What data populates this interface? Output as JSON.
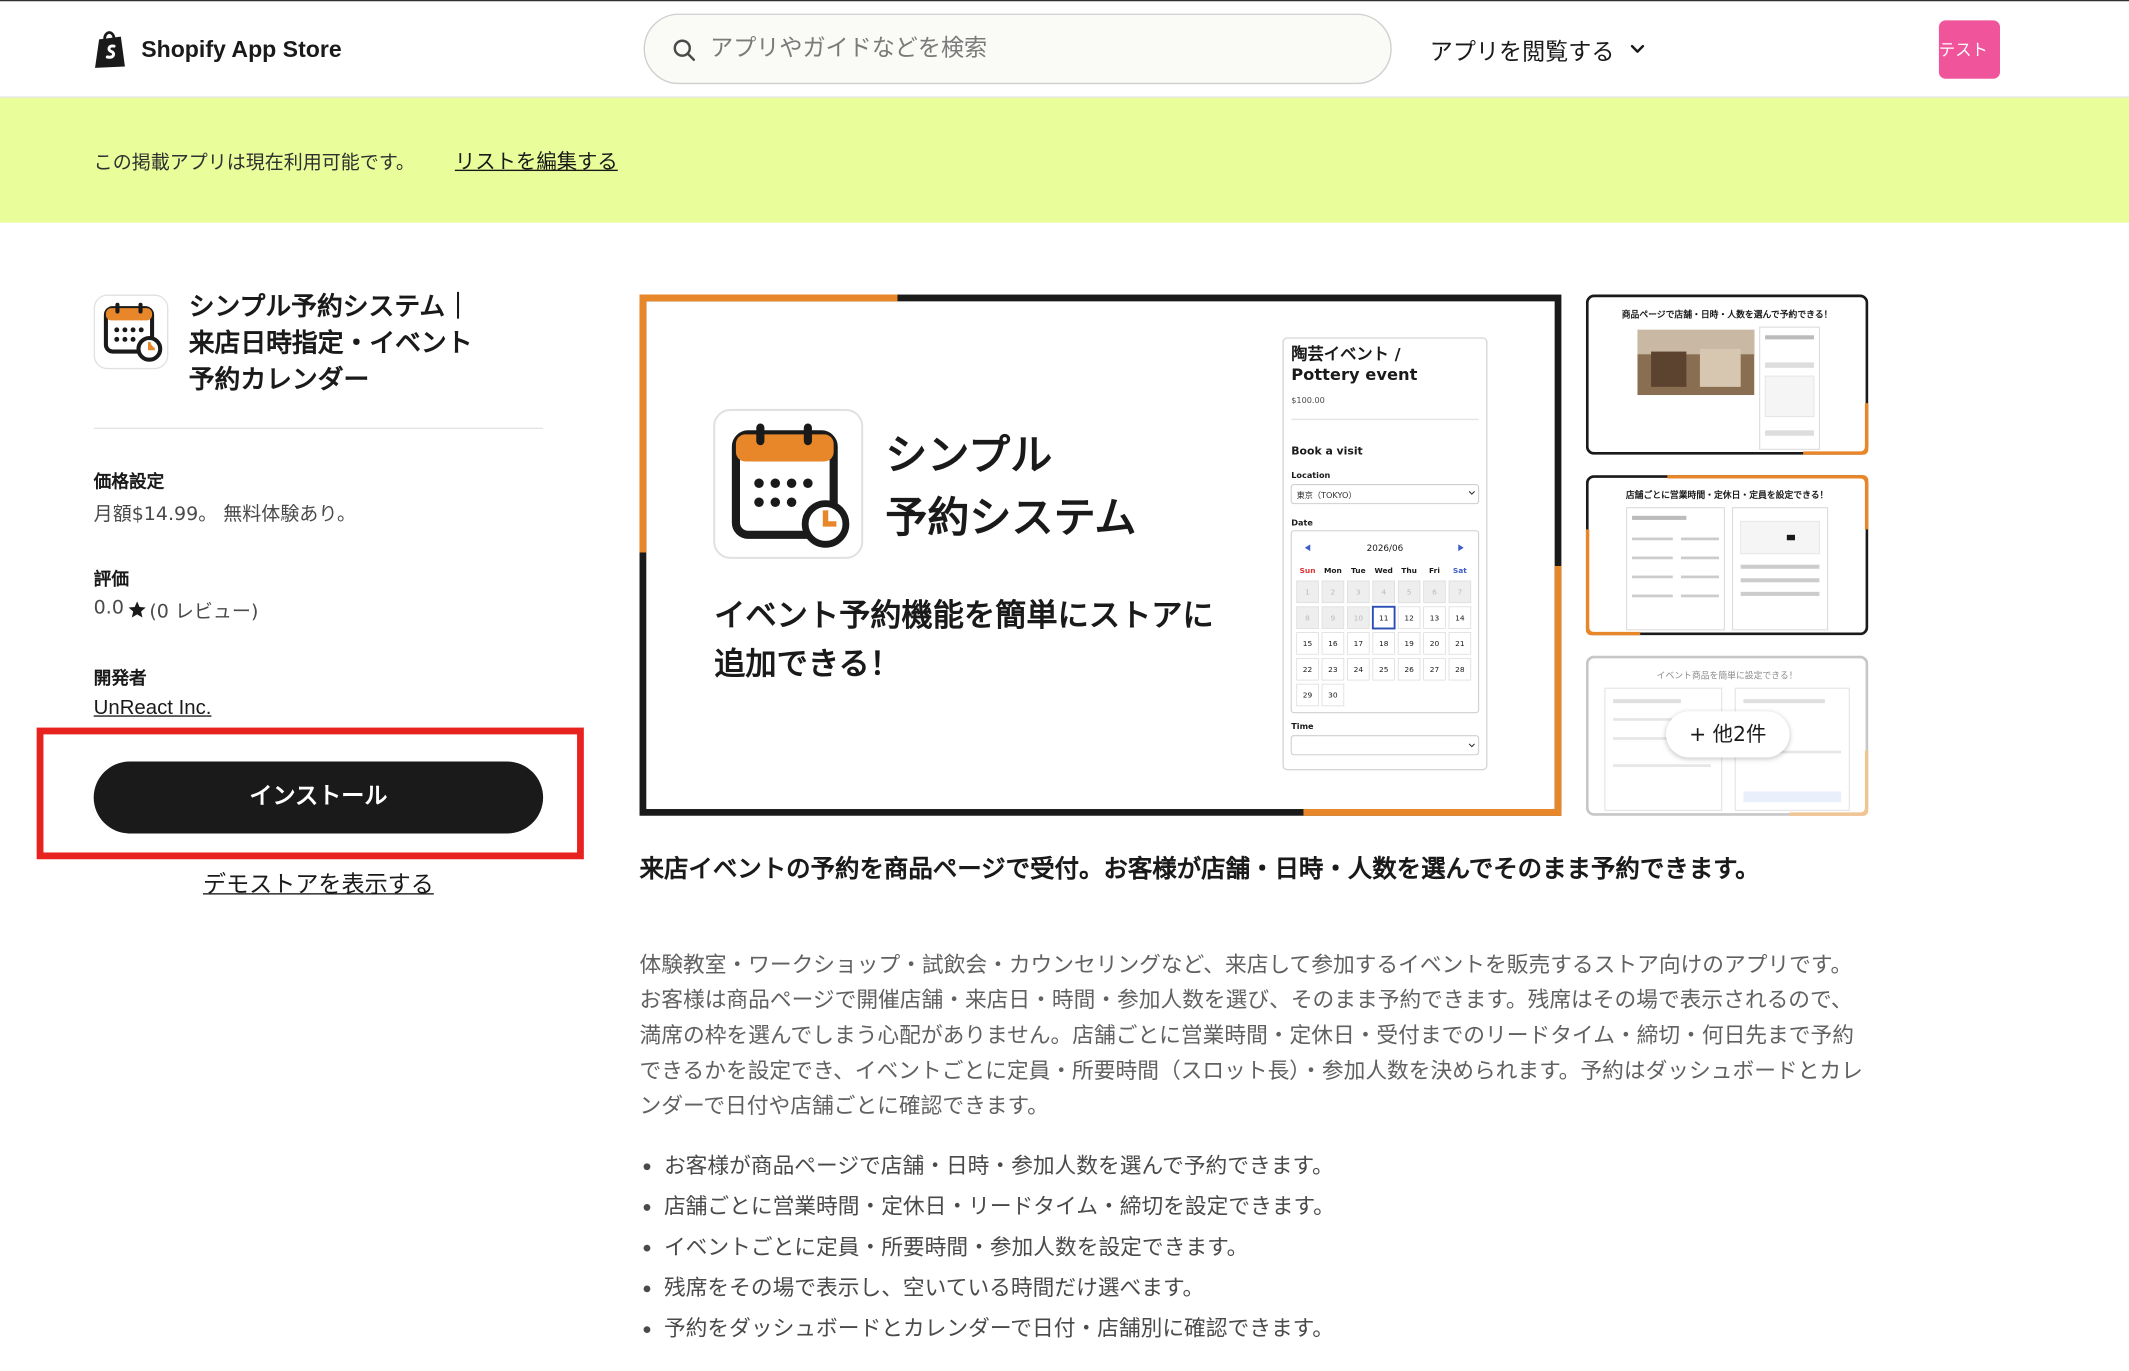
{
  "header": {
    "brand": "Shopify App Store",
    "search_placeholder": "アプリやガイドなどを検索",
    "browse_label": "アプリを閲覧する",
    "test_label": "テスト"
  },
  "banner": {
    "text": "この掲載アプリは現在利用可能です。",
    "link": "リストを編集する"
  },
  "app": {
    "title": "シンプル予約システム｜来店日時指定・イベント予約カレンダー",
    "pricing_label": "価格設定",
    "pricing_value": "月額$14.99。 無料体験あり。",
    "rating_label": "評価",
    "rating_value": "0.0",
    "rating_reviews": "(0 レビュー)",
    "developer_label": "開発者",
    "developer_name": "UnReact Inc.",
    "install_label": "インストール",
    "demo_label": "デモストアを表示する"
  },
  "hero": {
    "title_line1": "シンプル",
    "title_line2": "予約システム",
    "tagline_line1": "イベント予約機能を簡単にストアに",
    "tagline_line2": "追加できる！",
    "widget": {
      "event_title_line1": "陶芸イベント /",
      "event_title_line2": "Pottery event",
      "price": "$100.00",
      "book_label": "Book a visit",
      "location_label": "Location",
      "location_value": "東京（TOKYO）",
      "date_label": "Date",
      "month": "2026/06",
      "weekdays": [
        "Sun",
        "Mon",
        "Tue",
        "Wed",
        "Thu",
        "Fri",
        "Sat"
      ],
      "selected_day": "11",
      "time_label": "Time"
    }
  },
  "thumbnails": {
    "caption_1": "商品ページで店舗・日時・人数を選んで予約できる！",
    "caption_2": "店舗ごとに営業時間・定休日・定員を設定できる！",
    "caption_3": "イベント商品を簡単に設定できる！",
    "more_label": "+ 他2件"
  },
  "description": {
    "headline": "来店イベントの予約を商品ページで受付。お客様が店舗・日時・人数を選んでそのまま予約できます。",
    "body": "体験教室・ワークショップ・試飲会・カウンセリングなど、来店して参加するイベントを販売するストア向けのアプリです。お客様は商品ページで開催店舗・来店日・時間・参加人数を選び、そのまま予約できます。残席はその場で表示されるので、満席の枠を選んでしまう心配がありません。店舗ごとに営業時間・定休日・受付までのリードタイム・締切・何日先まで予約できるかを設定でき、イベントごとに定員・所要時間（スロット長）・参加人数を決められます。予約はダッシュボードとカレンダーで日付や店舗ごとに確認できます。",
    "features": [
      "お客様が商品ページで店舗・日時・参加人数を選んで予約できます。",
      "店舗ごとに営業時間・定休日・リードタイム・締切を設定できます。",
      "イベントごとに定員・所要時間・参加人数を設定できます。",
      "残席をその場で表示し、空いている時間だけ選べます。",
      "予約をダッシュボードとカレンダーで日付・店舗別に確認できます。"
    ]
  },
  "colors": {
    "accent_orange": "#e8862a",
    "banner_bg": "#e9fd9a",
    "install_bg": "#1a1a1a",
    "highlight_red": "#e8221f",
    "test_pink": "#f0559b"
  }
}
